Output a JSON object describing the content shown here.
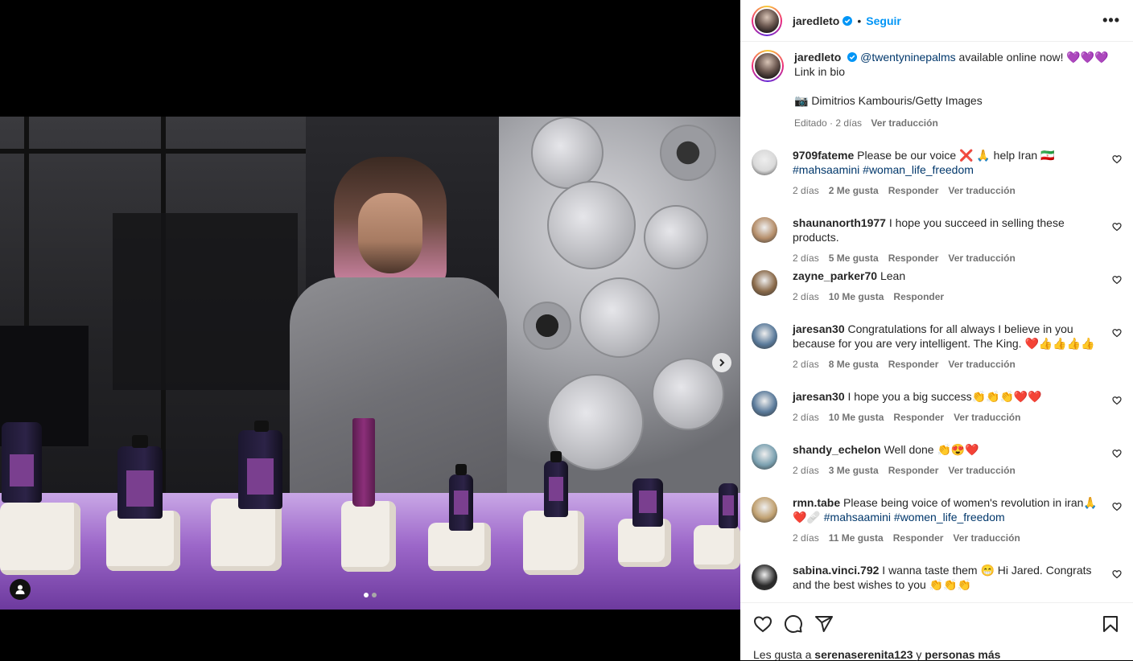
{
  "post": {
    "username": "jaredleto",
    "follow_label": "Seguir",
    "separator": "•",
    "more_label": "•••",
    "media": {
      "active_slide": 1,
      "slide_count": 2
    }
  },
  "caption": {
    "username": "jaredleto",
    "mention": "@twentyninepalms",
    "text": "available online now!",
    "hearts": "💜💜💜",
    "line2": "Link in bio",
    "credit": "📷 Dimitrios Kambouris/Getty Images",
    "edited": "Editado · 2 días",
    "translate": "Ver traducción"
  },
  "comments": [
    {
      "user": "9709fateme",
      "text_a": "Please be our voice ❌ 🙏 help Iran 🇮🇷",
      "hashtags": "#mahsaamini #woman_life_freedom",
      "time": "2 días",
      "likes": "2 Me gusta",
      "reply": "Responder",
      "translate": "Ver traducción",
      "avatar_color": "#d9d9d9"
    },
    {
      "user": "shaunanorth1977",
      "text_a": "I hope you succeed in selling these products.",
      "time": "2 días",
      "likes": "5 Me gusta",
      "reply": "Responder",
      "translate": "Ver traducción",
      "avatar_color": "#b58e6a"
    },
    {
      "user": "zayne_parker70",
      "text_a": "Lean",
      "time": "2 días",
      "likes": "10 Me gusta",
      "reply": "Responder",
      "avatar_color": "#8a6a4a"
    },
    {
      "user": "jaresan30",
      "text_a": "Congratulations for all always I believe in you because for you are very intelligent. The King. ❤️👍👍👍👍",
      "time": "2 días",
      "likes": "8 Me gusta",
      "reply": "Responder",
      "translate": "Ver traducción",
      "avatar_color": "#5a7a9a"
    },
    {
      "user": "jaresan30",
      "text_a": "I hope you a big success👏👏👏❤️❤️",
      "time": "2 días",
      "likes": "10 Me gusta",
      "reply": "Responder",
      "translate": "Ver traducción",
      "avatar_color": "#5a7a9a"
    },
    {
      "user": "shandy_echelon",
      "text_a": "Well done 👏😍❤️",
      "time": "2 días",
      "likes": "3 Me gusta",
      "reply": "Responder",
      "translate": "Ver traducción",
      "avatar_color": "#7aa0b0"
    },
    {
      "user": "rmn.tabe",
      "text_a": "Please being voice of women's revolution in iran🙏",
      "hashtags": "❤️🩹 #mahsaamini #women_life_freedom",
      "time": "2 días",
      "likes": "11 Me gusta",
      "reply": "Responder",
      "translate": "Ver traducción",
      "avatar_color": "#c0a070"
    },
    {
      "user": "sabina.vinci.792",
      "text_a": "I wanna taste them 😁 Hi Jared. Congrats and the best wishes to you 👏👏👏",
      "avatar_color": "#2a2a2a"
    }
  ],
  "footer": {
    "likes_prefix": "Les gusta a",
    "liked_by": "serenaserenita123",
    "likes_mid": "y",
    "likes_others": "personas más"
  },
  "colors": {
    "accent": "#0095f6",
    "link": "#00376b",
    "muted": "#737373"
  },
  "icons": [
    "more-icon",
    "verified-icon",
    "heart-icon",
    "comment-icon",
    "share-icon",
    "save-icon",
    "next-arrow-icon",
    "tag-user-icon"
  ]
}
